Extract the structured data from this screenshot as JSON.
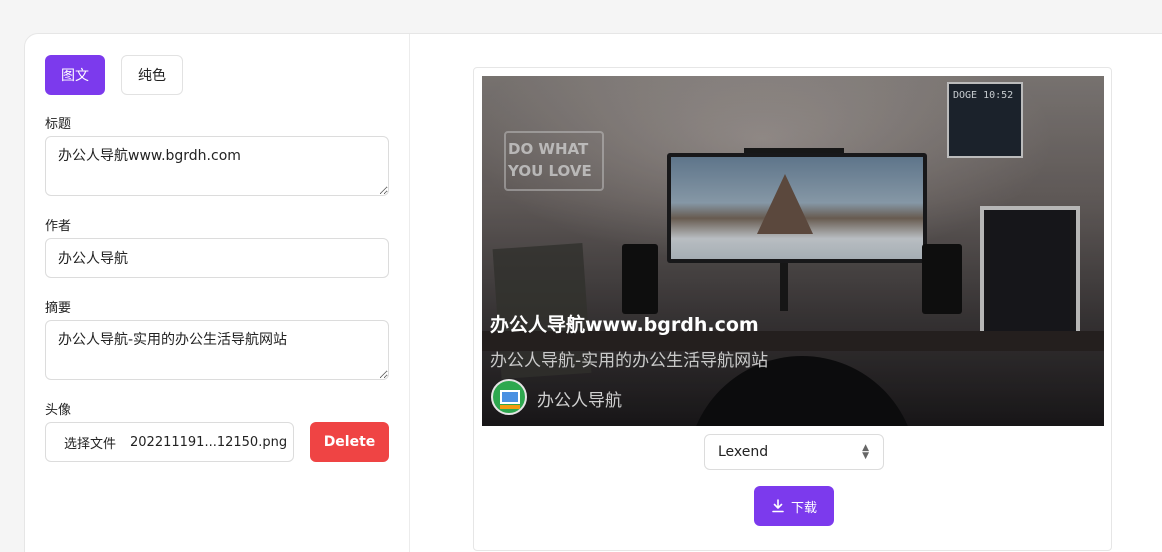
{
  "modes": {
    "image_text": "图文",
    "solid": "纯色"
  },
  "form": {
    "title_label": "标题",
    "title_value": "办公人导航www.bgrdh.com",
    "author_label": "作者",
    "author_value": "办公人导航",
    "summary_label": "摘要",
    "summary_value": "办公人导航-实用的办公生活导航网站",
    "avatar_label": "头像",
    "file_choose_label": "选择文件",
    "file_name": "202211191...12150.png",
    "delete_label": "Delete"
  },
  "preview": {
    "title": "办公人导航www.bgrdh.com",
    "summary": "办公人导航-实用的办公生活导航网站",
    "author": "办公人导航",
    "neon_text": "DO WHAT YOU LOVE",
    "clock_text": "DOGE 10:52"
  },
  "font_select": {
    "value": "Lexend"
  },
  "download": {
    "label": "下载"
  },
  "colors": {
    "accent": "#7c3aed",
    "danger": "#ef4444"
  }
}
